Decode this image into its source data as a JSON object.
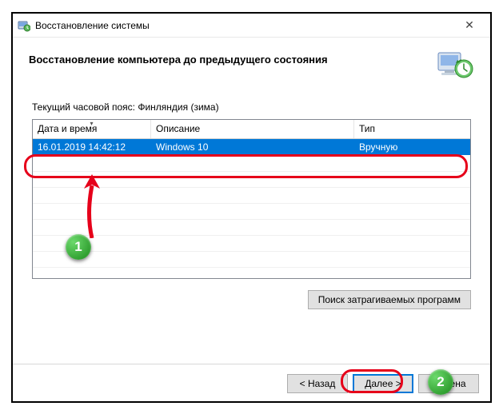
{
  "window": {
    "title": "Восстановление системы",
    "heading": "Восстановление компьютера до предыдущего состояния"
  },
  "timezone_label": "Текущий часовой пояс: Финляндия (зима)",
  "table": {
    "headers": {
      "datetime": "Дата и время",
      "description": "Описание",
      "type": "Тип"
    },
    "rows": [
      {
        "datetime": "16.01.2019 14:42:12",
        "description": "Windows 10",
        "type": "Вручную"
      }
    ]
  },
  "buttons": {
    "affected": "Поиск затрагиваемых программ",
    "back": "< Назад",
    "next": "Далее >",
    "cancel": "Отмена"
  },
  "annotations": {
    "badge1": "1",
    "badge2": "2"
  }
}
